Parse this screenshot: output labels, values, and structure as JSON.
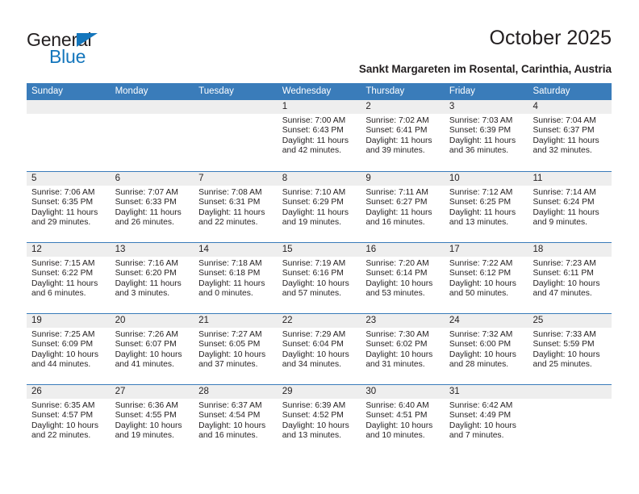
{
  "brand": {
    "name_part1": "General",
    "name_part2": "Blue",
    "accent_color": "#1476bc"
  },
  "header": {
    "title": "October 2025",
    "subtitle": "Sankt Margareten im Rosental, Carinthia, Austria"
  },
  "theme": {
    "header_blue": "#3a7cba",
    "daynum_band": "#eeeeee",
    "text": "#231f20"
  },
  "calendar": {
    "weekdays": [
      "Sunday",
      "Monday",
      "Tuesday",
      "Wednesday",
      "Thursday",
      "Friday",
      "Saturday"
    ],
    "weeks": [
      [
        {
          "day": "",
          "lines": []
        },
        {
          "day": "",
          "lines": []
        },
        {
          "day": "",
          "lines": []
        },
        {
          "day": "1",
          "lines": [
            "Sunrise: 7:00 AM",
            "Sunset: 6:43 PM",
            "Daylight: 11 hours",
            "and 42 minutes."
          ]
        },
        {
          "day": "2",
          "lines": [
            "Sunrise: 7:02 AM",
            "Sunset: 6:41 PM",
            "Daylight: 11 hours",
            "and 39 minutes."
          ]
        },
        {
          "day": "3",
          "lines": [
            "Sunrise: 7:03 AM",
            "Sunset: 6:39 PM",
            "Daylight: 11 hours",
            "and 36 minutes."
          ]
        },
        {
          "day": "4",
          "lines": [
            "Sunrise: 7:04 AM",
            "Sunset: 6:37 PM",
            "Daylight: 11 hours",
            "and 32 minutes."
          ]
        }
      ],
      [
        {
          "day": "5",
          "lines": [
            "Sunrise: 7:06 AM",
            "Sunset: 6:35 PM",
            "Daylight: 11 hours",
            "and 29 minutes."
          ]
        },
        {
          "day": "6",
          "lines": [
            "Sunrise: 7:07 AM",
            "Sunset: 6:33 PM",
            "Daylight: 11 hours",
            "and 26 minutes."
          ]
        },
        {
          "day": "7",
          "lines": [
            "Sunrise: 7:08 AM",
            "Sunset: 6:31 PM",
            "Daylight: 11 hours",
            "and 22 minutes."
          ]
        },
        {
          "day": "8",
          "lines": [
            "Sunrise: 7:10 AM",
            "Sunset: 6:29 PM",
            "Daylight: 11 hours",
            "and 19 minutes."
          ]
        },
        {
          "day": "9",
          "lines": [
            "Sunrise: 7:11 AM",
            "Sunset: 6:27 PM",
            "Daylight: 11 hours",
            "and 16 minutes."
          ]
        },
        {
          "day": "10",
          "lines": [
            "Sunrise: 7:12 AM",
            "Sunset: 6:25 PM",
            "Daylight: 11 hours",
            "and 13 minutes."
          ]
        },
        {
          "day": "11",
          "lines": [
            "Sunrise: 7:14 AM",
            "Sunset: 6:24 PM",
            "Daylight: 11 hours",
            "and 9 minutes."
          ]
        }
      ],
      [
        {
          "day": "12",
          "lines": [
            "Sunrise: 7:15 AM",
            "Sunset: 6:22 PM",
            "Daylight: 11 hours",
            "and 6 minutes."
          ]
        },
        {
          "day": "13",
          "lines": [
            "Sunrise: 7:16 AM",
            "Sunset: 6:20 PM",
            "Daylight: 11 hours",
            "and 3 minutes."
          ]
        },
        {
          "day": "14",
          "lines": [
            "Sunrise: 7:18 AM",
            "Sunset: 6:18 PM",
            "Daylight: 11 hours",
            "and 0 minutes."
          ]
        },
        {
          "day": "15",
          "lines": [
            "Sunrise: 7:19 AM",
            "Sunset: 6:16 PM",
            "Daylight: 10 hours",
            "and 57 minutes."
          ]
        },
        {
          "day": "16",
          "lines": [
            "Sunrise: 7:20 AM",
            "Sunset: 6:14 PM",
            "Daylight: 10 hours",
            "and 53 minutes."
          ]
        },
        {
          "day": "17",
          "lines": [
            "Sunrise: 7:22 AM",
            "Sunset: 6:12 PM",
            "Daylight: 10 hours",
            "and 50 minutes."
          ]
        },
        {
          "day": "18",
          "lines": [
            "Sunrise: 7:23 AM",
            "Sunset: 6:11 PM",
            "Daylight: 10 hours",
            "and 47 minutes."
          ]
        }
      ],
      [
        {
          "day": "19",
          "lines": [
            "Sunrise: 7:25 AM",
            "Sunset: 6:09 PM",
            "Daylight: 10 hours",
            "and 44 minutes."
          ]
        },
        {
          "day": "20",
          "lines": [
            "Sunrise: 7:26 AM",
            "Sunset: 6:07 PM",
            "Daylight: 10 hours",
            "and 41 minutes."
          ]
        },
        {
          "day": "21",
          "lines": [
            "Sunrise: 7:27 AM",
            "Sunset: 6:05 PM",
            "Daylight: 10 hours",
            "and 37 minutes."
          ]
        },
        {
          "day": "22",
          "lines": [
            "Sunrise: 7:29 AM",
            "Sunset: 6:04 PM",
            "Daylight: 10 hours",
            "and 34 minutes."
          ]
        },
        {
          "day": "23",
          "lines": [
            "Sunrise: 7:30 AM",
            "Sunset: 6:02 PM",
            "Daylight: 10 hours",
            "and 31 minutes."
          ]
        },
        {
          "day": "24",
          "lines": [
            "Sunrise: 7:32 AM",
            "Sunset: 6:00 PM",
            "Daylight: 10 hours",
            "and 28 minutes."
          ]
        },
        {
          "day": "25",
          "lines": [
            "Sunrise: 7:33 AM",
            "Sunset: 5:59 PM",
            "Daylight: 10 hours",
            "and 25 minutes."
          ]
        }
      ],
      [
        {
          "day": "26",
          "lines": [
            "Sunrise: 6:35 AM",
            "Sunset: 4:57 PM",
            "Daylight: 10 hours",
            "and 22 minutes."
          ]
        },
        {
          "day": "27",
          "lines": [
            "Sunrise: 6:36 AM",
            "Sunset: 4:55 PM",
            "Daylight: 10 hours",
            "and 19 minutes."
          ]
        },
        {
          "day": "28",
          "lines": [
            "Sunrise: 6:37 AM",
            "Sunset: 4:54 PM",
            "Daylight: 10 hours",
            "and 16 minutes."
          ]
        },
        {
          "day": "29",
          "lines": [
            "Sunrise: 6:39 AM",
            "Sunset: 4:52 PM",
            "Daylight: 10 hours",
            "and 13 minutes."
          ]
        },
        {
          "day": "30",
          "lines": [
            "Sunrise: 6:40 AM",
            "Sunset: 4:51 PM",
            "Daylight: 10 hours",
            "and 10 minutes."
          ]
        },
        {
          "day": "31",
          "lines": [
            "Sunrise: 6:42 AM",
            "Sunset: 4:49 PM",
            "Daylight: 10 hours",
            "and 7 minutes."
          ]
        },
        {
          "day": "",
          "lines": []
        }
      ]
    ]
  }
}
